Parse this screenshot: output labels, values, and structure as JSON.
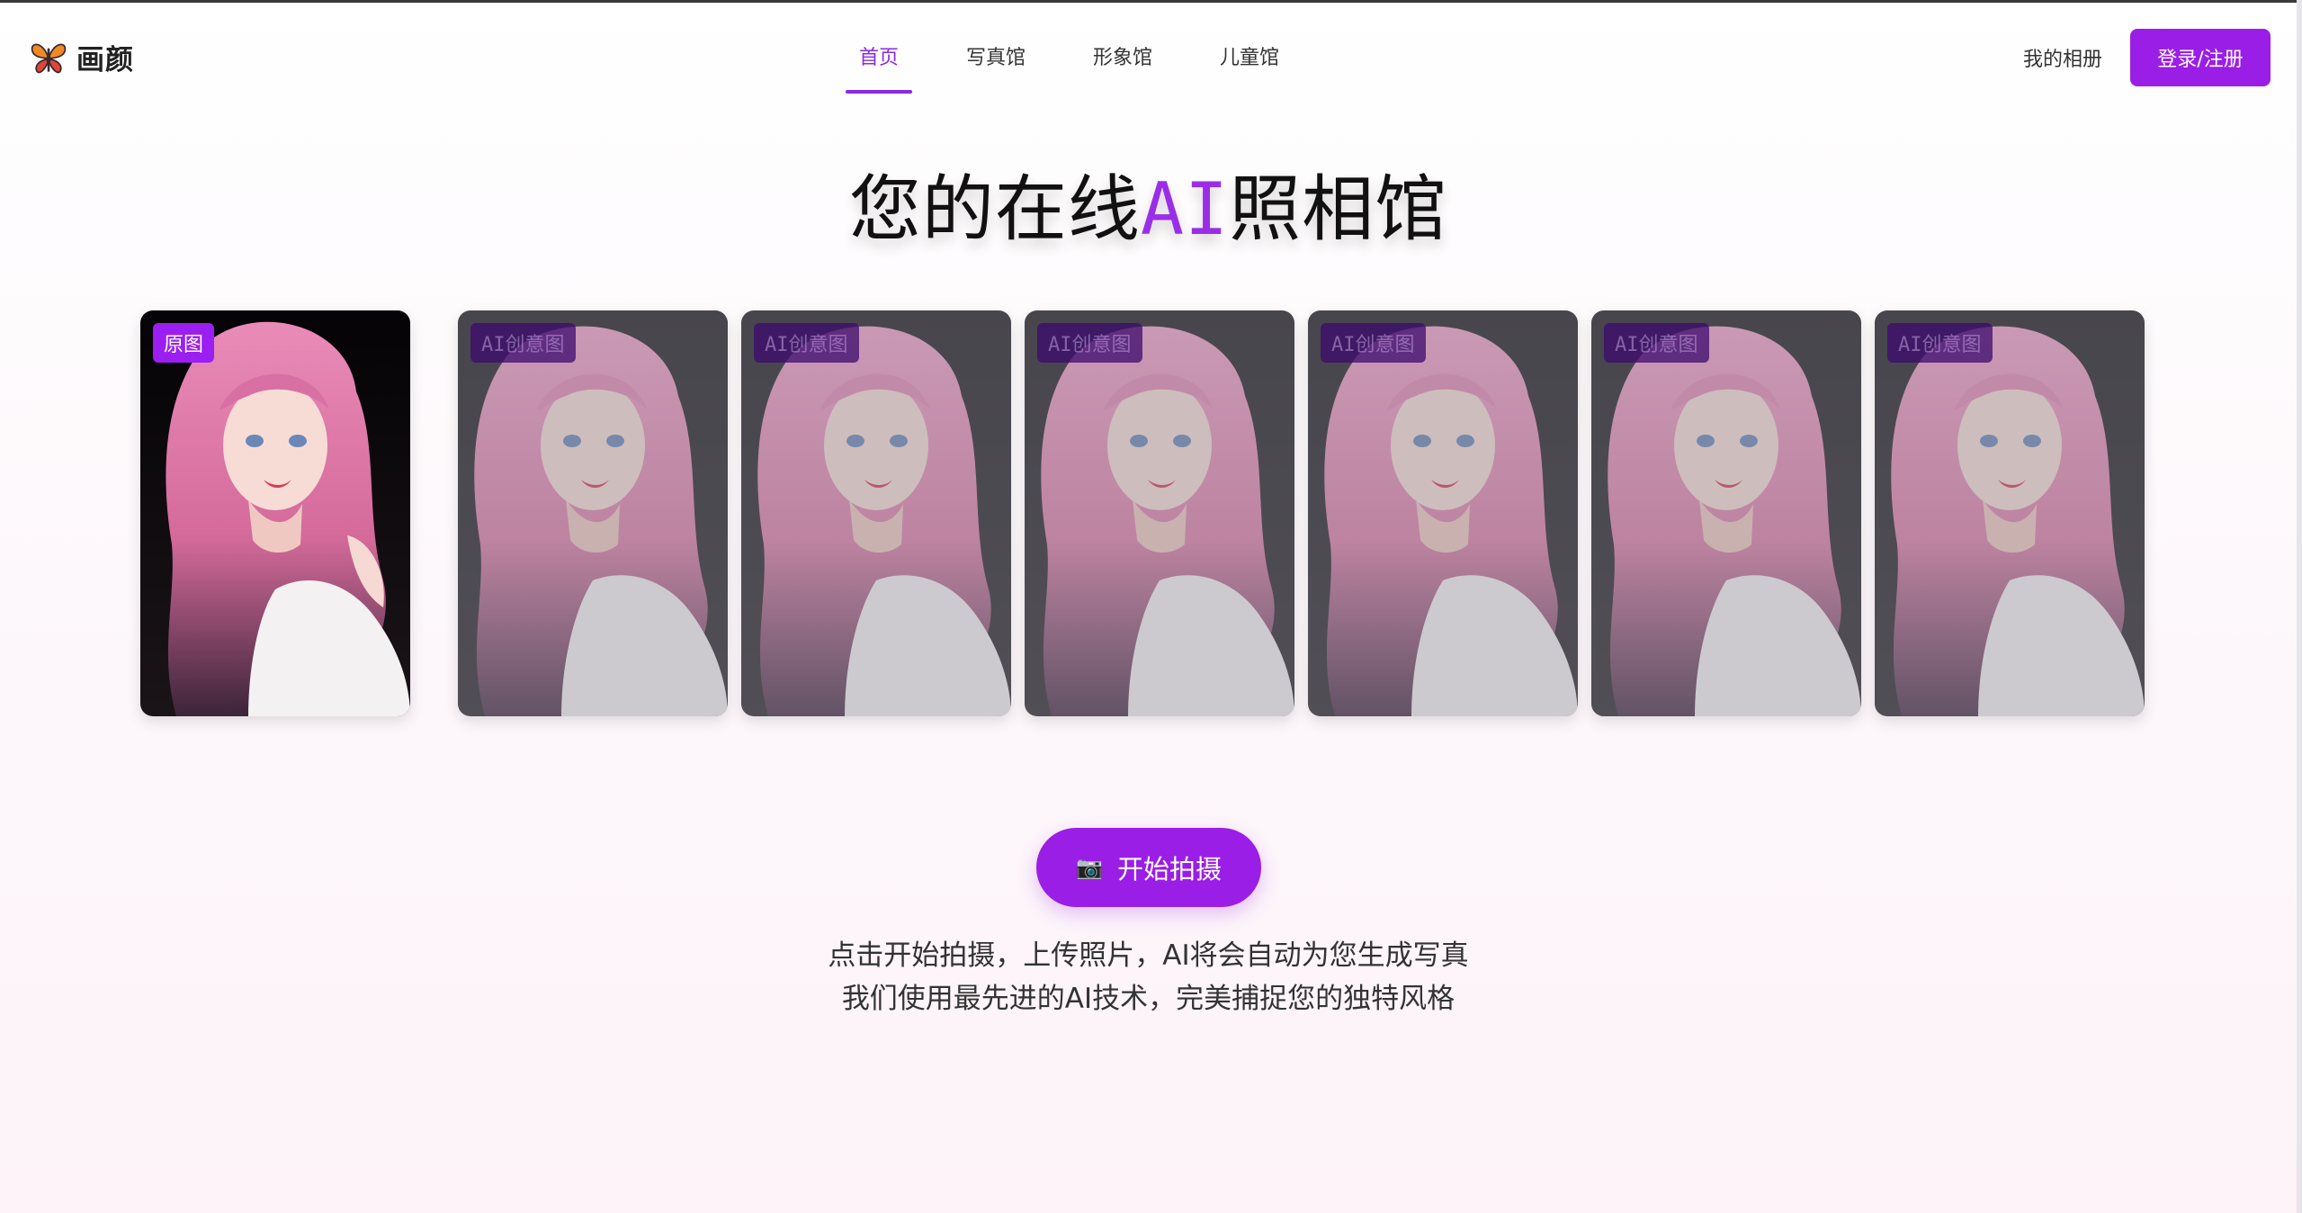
{
  "brand": {
    "name": "画颜",
    "logo_icon": "butterfly-icon",
    "accent_color": "#9a1ee6"
  },
  "nav": {
    "items": [
      {
        "label": "首页",
        "active": true
      },
      {
        "label": "写真馆",
        "active": false
      },
      {
        "label": "形象馆",
        "active": false
      },
      {
        "label": "儿童馆",
        "active": false
      }
    ]
  },
  "header": {
    "my_album": "我的相册",
    "login_label": "登录/注册"
  },
  "hero": {
    "title_before": "您的在线",
    "title_accent": "AI",
    "title_after": "照相馆"
  },
  "photos": {
    "original_label": "原图",
    "ai_label": "AI创意图",
    "ai_count": 6
  },
  "cta": {
    "icon": "camera-icon",
    "label": "开始拍摄"
  },
  "description": {
    "line1": "点击开始拍摄，上传照片，AI将会自动为您生成写真",
    "line2": "我们使用最先进的AI技术，完美捕捉您的独特风格"
  }
}
